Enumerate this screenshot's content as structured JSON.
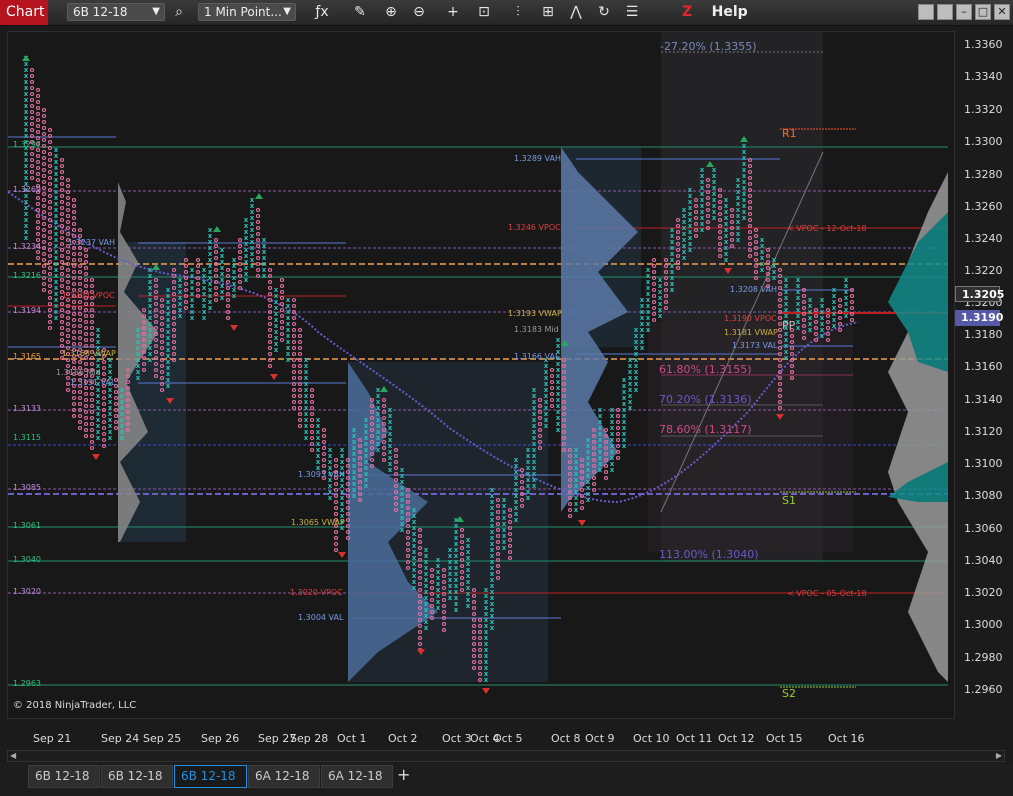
{
  "toolbar": {
    "chart_tab": "Chart",
    "instrument": "6B 12-18",
    "interval": "1 Min Point...",
    "help": "Help",
    "z_logo": "Z"
  },
  "colors": {
    "accent_red": "#b5141e",
    "bull_x": "#2bbfb5",
    "bear_o": "#e06fa0",
    "active_tab": "#1f8fe0",
    "current_price_bg": "#3a3a3a",
    "vwap_tag_bg": "#5559a8"
  },
  "yaxis": {
    "ticks": [
      "1.3360",
      "1.3340",
      "1.3320",
      "1.3300",
      "1.3280",
      "1.3260",
      "1.3240",
      "1.3220",
      "1.3200",
      "1.3180",
      "1.3160",
      "1.3140",
      "1.3120",
      "1.3100",
      "1.3080",
      "1.3060",
      "1.3040",
      "1.3020",
      "1.3000",
      "1.2980",
      "1.2960"
    ],
    "current_price": "1.3205",
    "vwap_price": "1.3190"
  },
  "xaxis": {
    "labels": [
      "Sep 21",
      "Sep 24",
      "Sep 25",
      "Sep 26",
      "Sep 27",
      "Sep 28",
      "Oct 1",
      "Oct 2",
      "Oct 3",
      "Oct 4",
      "Oct 5",
      "Oct 8",
      "Oct 9",
      "Oct 10",
      "Oct 11",
      "Oct 12",
      "Oct 15",
      "Oct 16"
    ]
  },
  "levels": {
    "left": [
      "1.3297",
      "1.3269",
      "1.3234",
      "1.3216",
      "1.3194",
      "1.3165",
      "1.3133",
      "1.3115",
      "1.3085",
      "1.3061",
      "1.3040",
      "1.3020",
      "1.2963"
    ],
    "sep24_vah": "1.3237 VAH",
    "sep24_vpoc": "1.3204 VPOC",
    "sep24_vwap": "1.3168 VWAP",
    "sep24_mid": "1.3156 Mid",
    "sep24_val": "1.3151 VAL",
    "oct1_vah": "1.3093 VAH",
    "oct1_vwap": "1.3065 VWAP",
    "oct1_vpoc": "1.3020 VPOC",
    "oct1_val": "1.3004 VAL",
    "oct8_vah": "1.3289 VAH",
    "oct8_vpoc": "1.3246 VPOC",
    "oct8_vwap": "1.3193 VWAP",
    "oct8_mid": "1.3183 Mid",
    "oct8_val": "1.3166 VAL",
    "oct15_vah": "1.3208 VAH",
    "oct15_vpoc": "1.3190 VPOC",
    "oct15_vwap": "1.3181 VWAP",
    "oct15_val": "1.3173 VAL",
    "vpoc_12oct": "< VPOC - 12-Oct-18",
    "vpoc_05oct": "< VPOC - 05-Oct-18"
  },
  "pivots": {
    "r1": "R1",
    "pp": "PP",
    "s1": "S1",
    "s2": "S2"
  },
  "fibs": {
    "f1": "-27.20% (1.3355)",
    "f2": "61.80% (1.3155)",
    "f3": "70.20% (1.3136)",
    "f4": "78.60% (1.3117)",
    "f5": "113.00% (1.3040)",
    "f6": "1.3208 VAH"
  },
  "copyright": "© 2018 NinjaTrader, LLC",
  "tabs": [
    "6B 12-18",
    "6B 12-18",
    "6B 12-18",
    "6A 12-18",
    "6A 12-18"
  ],
  "active_tab_index": 2,
  "add_tab": "+"
}
